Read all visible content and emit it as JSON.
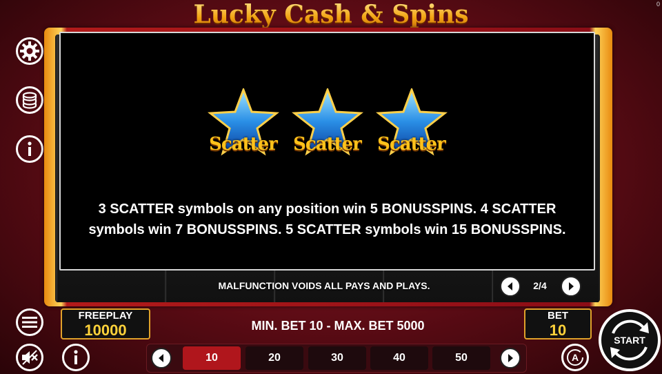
{
  "game": {
    "title": "Lucky Cash & Spins",
    "corner_counter": "0"
  },
  "side_menu": [
    {
      "icon": "gear-icon"
    },
    {
      "icon": "coins-icon"
    },
    {
      "icon": "info-icon"
    }
  ],
  "paytable": {
    "symbols": [
      {
        "icon": "blue-star-icon",
        "label": "Scatter"
      },
      {
        "icon": "blue-star-icon",
        "label": "Scatter"
      },
      {
        "icon": "blue-star-icon",
        "label": "Scatter"
      }
    ],
    "description": "3 SCATTER symbols on any position win 5 BONUSSPINS. 4 SCATTER symbols win 7 BONUSSPINS. 5 SCATTER symbols win 15 BONUSSPINS.",
    "page": "2/4"
  },
  "info_bar": {
    "malfunction": "MALFUNCTION VOIDS ALL PAYS AND PLAYS."
  },
  "freeplay": {
    "label": "FREEPLAY",
    "value": "10000"
  },
  "bet": {
    "label": "BET",
    "value": "10"
  },
  "limits": "MIN. BET 10 - MAX. BET 5000",
  "bet_options": [
    "10",
    "20",
    "30",
    "40",
    "50"
  ],
  "selected_bet": "10",
  "start_label": "START",
  "colors": {
    "accent": "#ffcf3a",
    "active_bet": "#b0161c",
    "background": "#7a1420"
  }
}
